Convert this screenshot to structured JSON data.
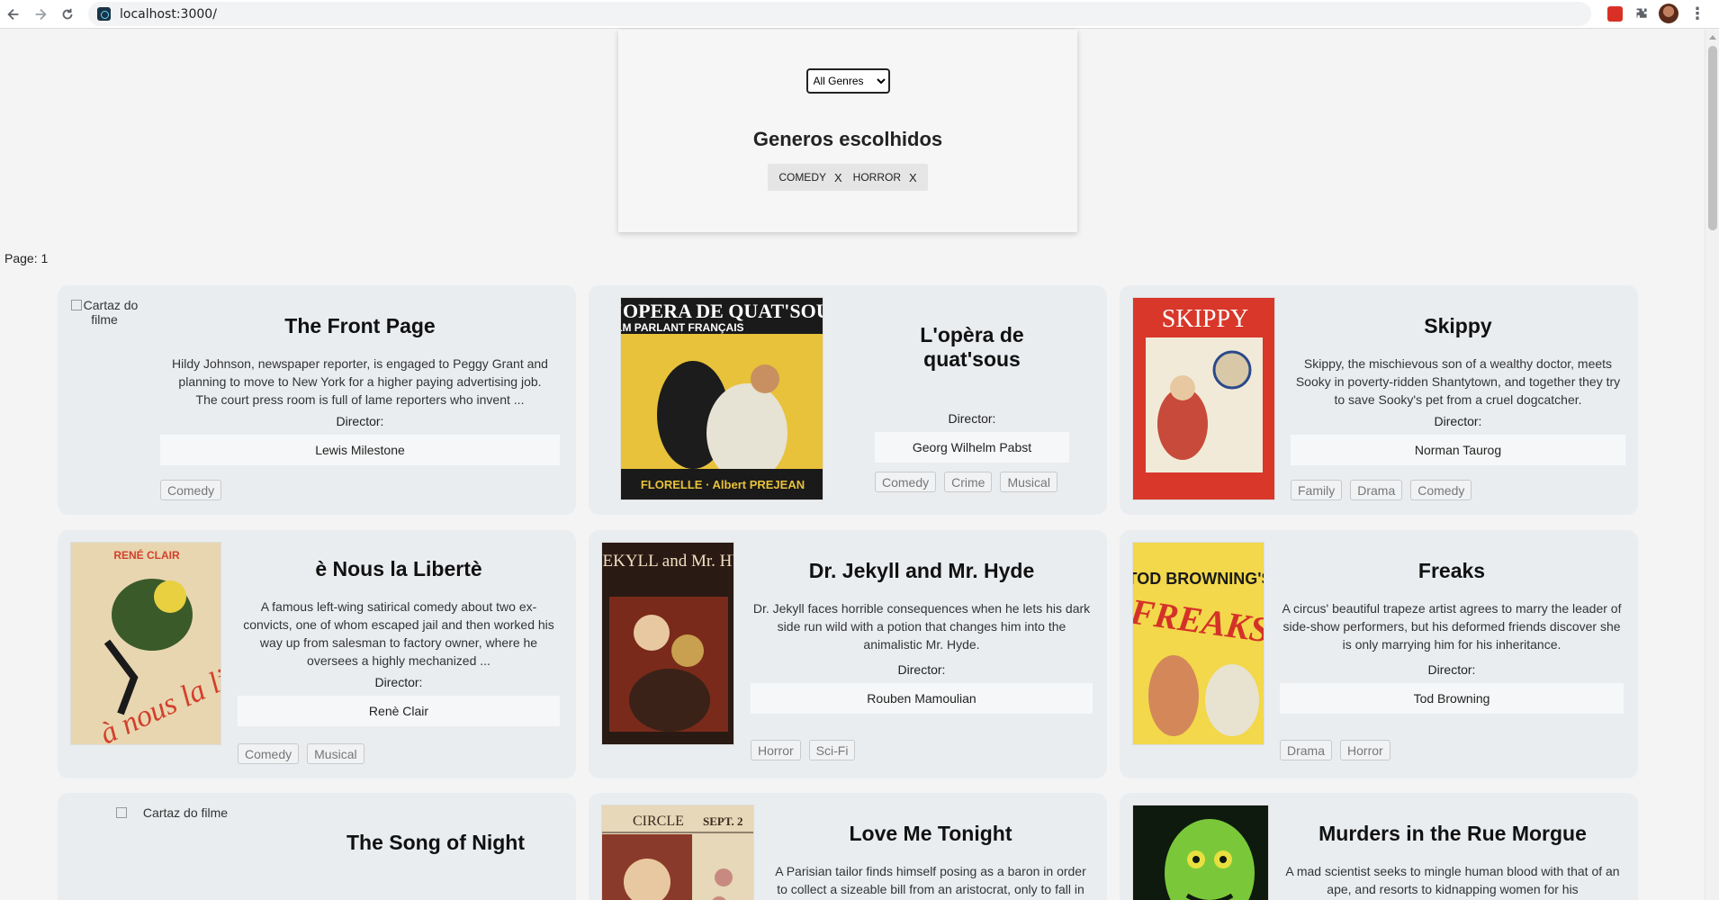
{
  "browser": {
    "url": "localhost:3000/"
  },
  "filter": {
    "select_value": "All Genres",
    "chosen_title": "Generos escolhidos",
    "chips": [
      {
        "label": "COMEDY",
        "remove": "X"
      },
      {
        "label": "HORROR",
        "remove": "X"
      }
    ]
  },
  "page_label": "Page: 1",
  "poster_alt": "Cartaz do filme",
  "director_label": "Director:",
  "movies": [
    {
      "title": "The Front Page",
      "description": "Hildy Johnson, newspaper reporter, is engaged to Peggy Grant and planning to move to New York for a higher paying advertising job. The court press room is full of lame reporters who invent ...",
      "director": "Lewis Milestone",
      "genres": [
        "Comedy"
      ]
    },
    {
      "title": "L'opèra de quat'sous",
      "description": "",
      "director": "Georg Wilhelm Pabst",
      "genres": [
        "Comedy",
        "Crime",
        "Musical"
      ]
    },
    {
      "title": "Skippy",
      "description": "Skippy, the mischievous son of a wealthy doctor, meets Sooky in poverty-ridden Shantytown, and together they try to save Sooky's pet from a cruel dogcatcher.",
      "director": "Norman Taurog",
      "genres": [
        "Family",
        "Drama",
        "Comedy"
      ]
    },
    {
      "title": "è Nous la Libertè",
      "description": "A famous left-wing satirical comedy about two ex-convicts, one of whom escaped jail and then worked his way up from salesman to factory owner, where he oversees a highly mechanized ...",
      "director": "Renè Clair",
      "genres": [
        "Comedy",
        "Musical"
      ]
    },
    {
      "title": "Dr. Jekyll and Mr. Hyde",
      "description": "Dr. Jekyll faces horrible consequences when he lets his dark side run wild with a potion that changes him into the animalistic Mr. Hyde.",
      "director": "Rouben Mamoulian",
      "genres": [
        "Horror",
        "Sci-Fi"
      ]
    },
    {
      "title": "Freaks",
      "description": "A circus' beautiful trapeze artist agrees to marry the leader of side-show performers, but his deformed friends discover she is only marrying him for his inheritance.",
      "director": "Tod Browning",
      "genres": [
        "Drama",
        "Horror"
      ]
    },
    {
      "title": "The Song of Night"
    },
    {
      "title": "Love Me Tonight",
      "description": "A Parisian tailor finds himself posing as a baron in order to collect a sizeable bill from an aristocrat, only to fall in"
    },
    {
      "title": "Murders in the Rue Morgue",
      "description": "A mad scientist seeks to mingle human blood with that of an ape, and resorts to kidnapping women for his"
    }
  ],
  "posters": {
    "opera": {
      "top_text": "L'OPERA DE QUAT'SOUS",
      "sub_text": "FILM PARLANT FRANÇAIS",
      "bottom_text": "FLORELLE · Albert PREJEAN",
      "colors": [
        "#e8c23a",
        "#1a1a1a",
        "#d8d2c0"
      ]
    },
    "skippy": {
      "top_text": "SKIPPY",
      "colors": [
        "#d8372a",
        "#f2ead8",
        "#2a4a8a"
      ]
    },
    "liberte": {
      "top_text": "RENÉ CLAIR",
      "script_text": "à nous la liberté!",
      "colors": [
        "#e8d6b0",
        "#d2402c",
        "#3a5a2a"
      ]
    },
    "jekyll": {
      "top_text": "Dr. JEKYLL and Mr. HYDE",
      "colors": [
        "#2a1a14",
        "#c8a050",
        "#7a2a1a"
      ]
    },
    "freaks": {
      "top_text": "TOD BROWNING'S",
      "big_text": "FREAKS",
      "colors": [
        "#f2d84a",
        "#d43228",
        "#1a1a1a"
      ]
    },
    "love": {
      "top_text": "CIRCLE",
      "side_text": "SEPT. 2",
      "colors": [
        "#e6d8b8",
        "#8a3a2a",
        "#3a2a20"
      ]
    },
    "murders": {
      "colors": [
        "#0e1a0e",
        "#7ac83a",
        "#e8e040"
      ]
    }
  }
}
